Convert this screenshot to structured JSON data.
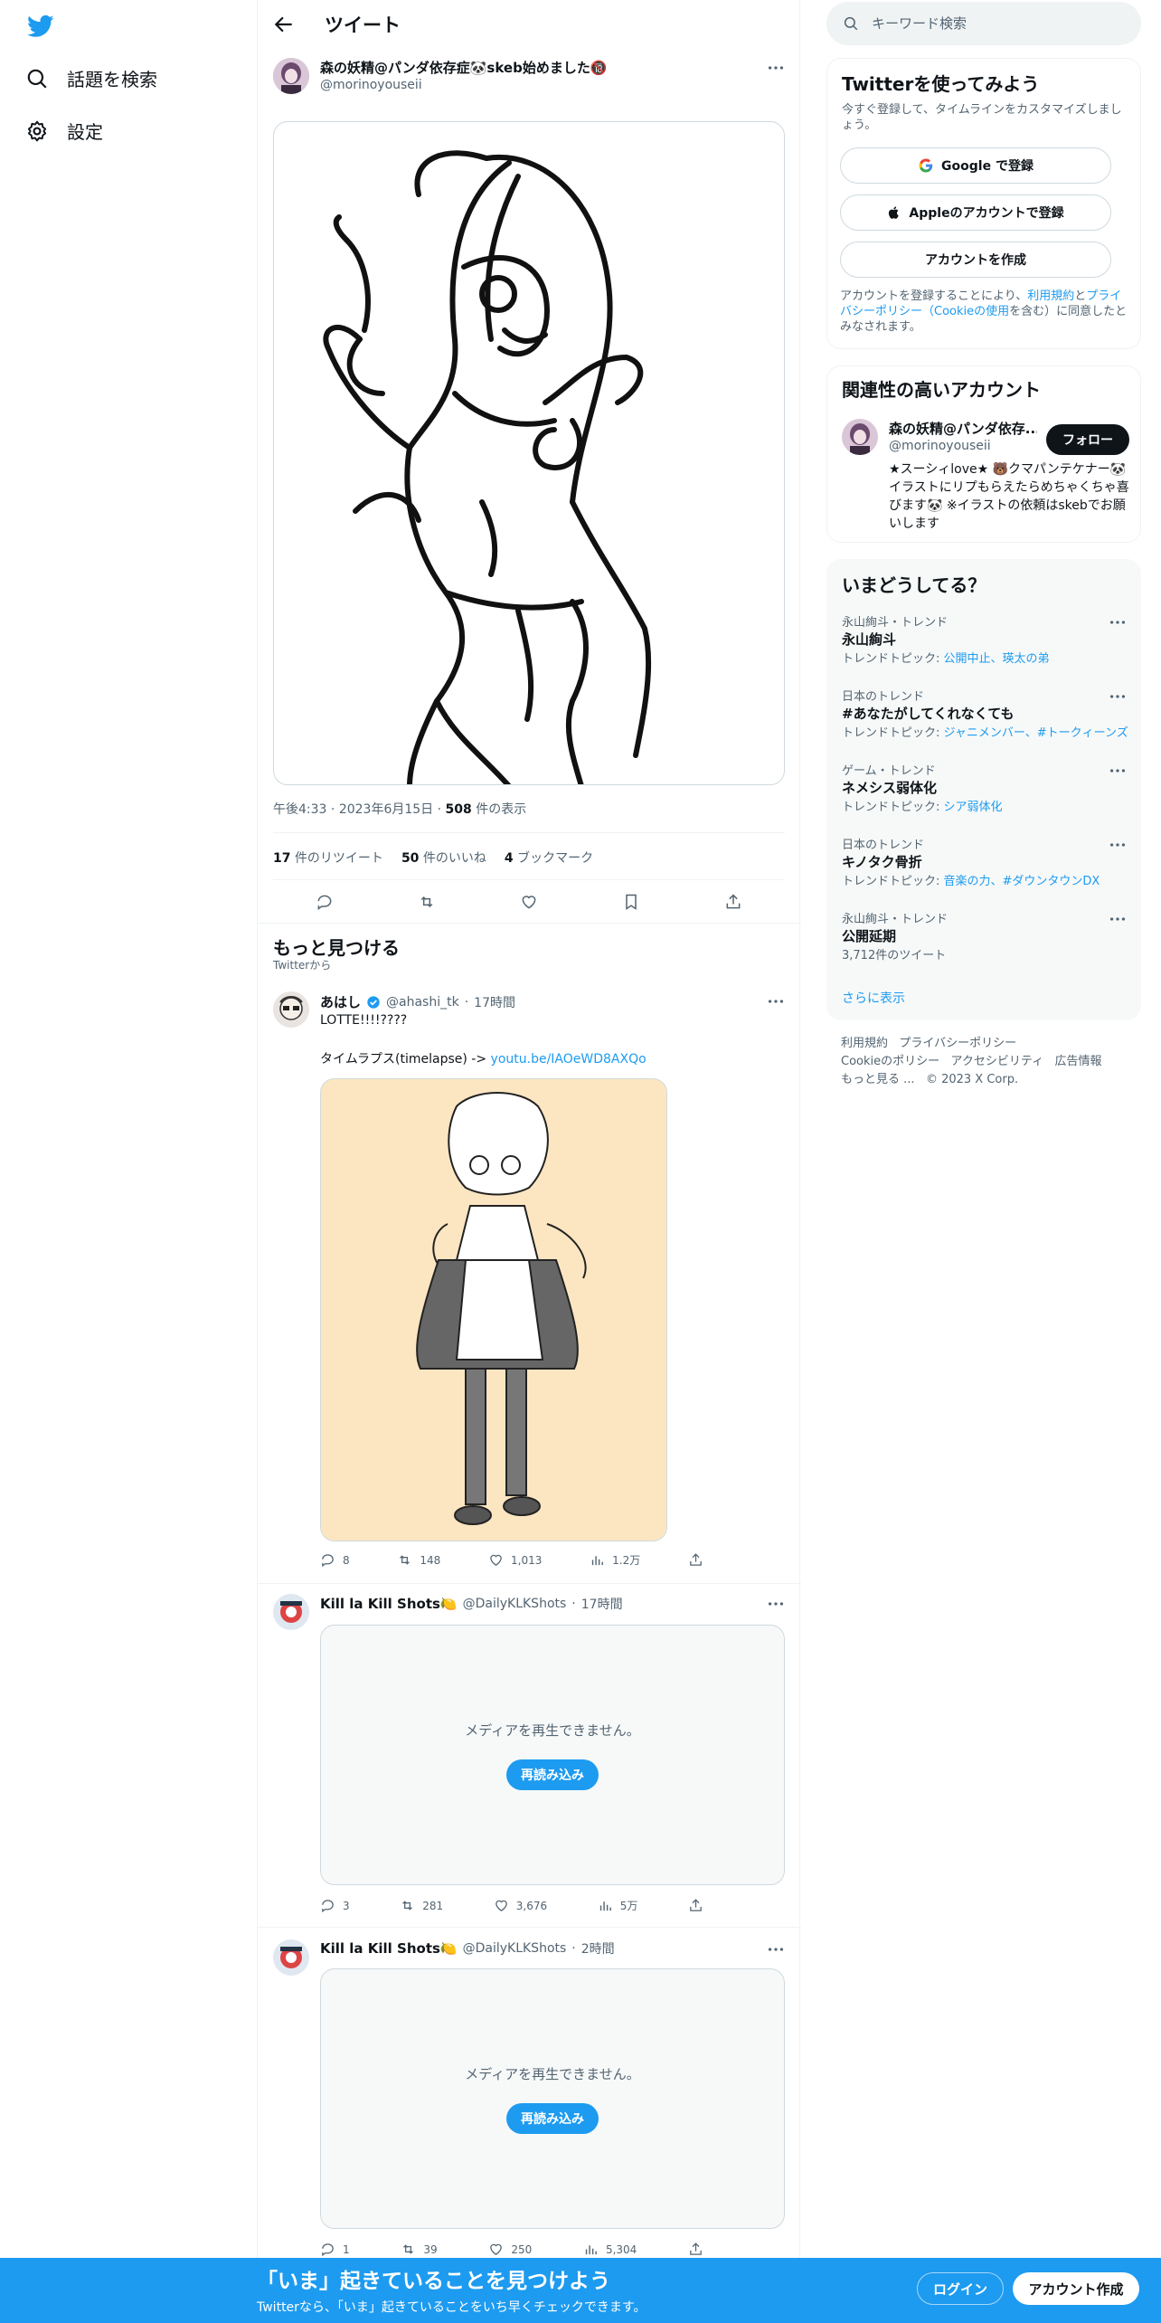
{
  "colors": {
    "brand": "#1d9bf0",
    "text": "#0f1419",
    "muted": "#536471",
    "border": "#eff3f4"
  },
  "sidebar": {
    "logo_icon": "twitter-bird-icon",
    "items": [
      {
        "label": "話題を検索",
        "icon": "search-icon"
      },
      {
        "label": "設定",
        "icon": "gear-icon"
      }
    ]
  },
  "header": {
    "title": "ツイート"
  },
  "tweet": {
    "author_name": "森の妖精@パンダ依存症🐼skeb始めました🔞",
    "author_handle": "@morinoyouseii",
    "time": "午後4:33",
    "date": "2023年6月15日",
    "views_count": "508",
    "views_label": "件の表示",
    "retweets_count": "17",
    "retweets_label": "件のリツイート",
    "likes_count": "50",
    "likes_label": "件のいいね",
    "bookmarks_count": "4",
    "bookmarks_label": "ブックマーク"
  },
  "more_section": {
    "title": "もっと見つける",
    "subtitle": "Twitterから"
  },
  "feed": [
    {
      "name": "あはし",
      "verified": true,
      "handle": "@ahashi_tk",
      "time": "17時間",
      "text1": "LOTTE!!!!????",
      "text2": "タイムラプス(timelapse) ->",
      "link": "youtu.be/IAOeWD8AXQo",
      "replies": "8",
      "retweets": "148",
      "likes": "1,013",
      "views": "1.2万"
    },
    {
      "name": "Kill la Kill Shots🍋",
      "handle": "@DailyKLKShots",
      "time": "17時間",
      "media_message": "メディアを再生できません。",
      "reload_label": "再読み込み",
      "replies": "3",
      "retweets": "281",
      "likes": "3,676",
      "views": "5万"
    },
    {
      "name": "Kill la Kill Shots🍋",
      "handle": "@DailyKLKShots",
      "time": "2時間",
      "media_message": "メディアを再生できません。",
      "reload_label": "再読み込み",
      "replies": "1",
      "retweets": "39",
      "likes": "250",
      "views": "5,304"
    }
  ],
  "right": {
    "search_placeholder": "キーワード検索",
    "signup": {
      "title": "Twitterを使ってみよう",
      "desc": "今すぐ登録して、タイムラインをカスタマイズしましょう。",
      "google": "Google で登録",
      "apple": "Appleのアカウントで登録",
      "create": "アカウントを作成",
      "terms_1": "アカウントを登録することにより、",
      "terms_link1": "利用規約",
      "terms_2": "と",
      "terms_link2": "プライバシーポリシー（Cookieの使用",
      "terms_3": "を含む）に同意したとみなされます。"
    },
    "relevant": {
      "title": "関連性の高いアカウント",
      "name": "森の妖精@パンダ依存...",
      "handle": "@morinoyouseii",
      "follow": "フォロー",
      "bio": "★スーシィlove★ 🐻クマパンテケナー🐼 イラストにリプもらえたらめちゃくちゃ喜びます🐼 ※イラストの依頼はskebでお願いします"
    },
    "trends": {
      "title": "いまどうしてる？",
      "items": [
        {
          "context": "永山絢斗・トレンド",
          "name": "永山絢斗",
          "sub_prefix": "トレンドトピック: ",
          "sub_link": "公開中止、瑛太の弟"
        },
        {
          "context": "日本のトレンド",
          "name": "#あなたがしてくれなくても",
          "sub_prefix": "トレンドトピック: ",
          "sub_link": "ジャニメンバー、#トークィーンズ"
        },
        {
          "context": "ゲーム・トレンド",
          "name": "ネメシス弱体化",
          "sub_prefix": "トレンドトピック: ",
          "sub_link": "シア弱体化"
        },
        {
          "context": "日本のトレンド",
          "name": "キノタク骨折",
          "sub_prefix": "トレンドトピック: ",
          "sub_link": "音楽の力、#ダウンタウンDX"
        },
        {
          "context": "永山絢斗・トレンド",
          "name": "公開延期",
          "sub_prefix": "3,712件のツイート",
          "sub_link": ""
        }
      ],
      "show_more": "さらに表示"
    },
    "footer": {
      "links": [
        "利用規約",
        "プライバシーポリシー",
        "Cookieのポリシー",
        "アクセシビリティ",
        "広告情報",
        "もっと見る ...",
        "© 2023 X Corp."
      ]
    }
  },
  "bottom_bar": {
    "title": "「いま」起きていることを見つけよう",
    "subtitle": "Twitterなら、「いま」起きていることをいち早くチェックできます。",
    "login": "ログイン",
    "signup": "アカウント作成"
  }
}
